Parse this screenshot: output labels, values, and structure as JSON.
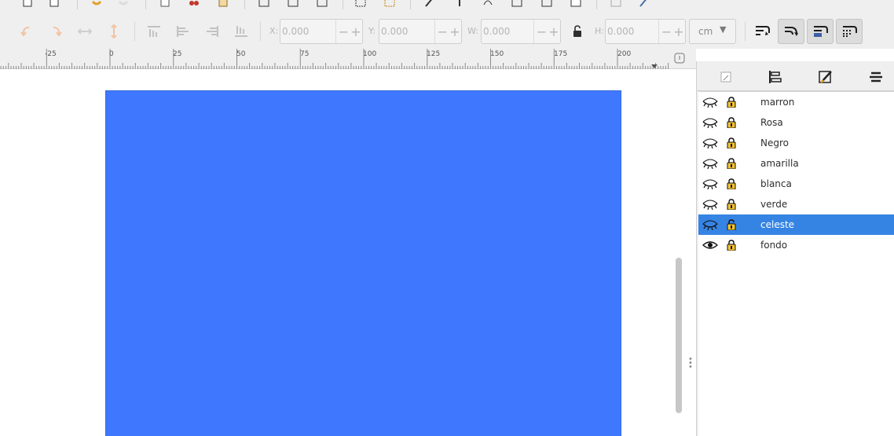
{
  "toolbar": {
    "x_label": "X:",
    "y_label": "Y:",
    "w_label": "W:",
    "h_label": "H:",
    "x_value": "0.000",
    "y_value": "0.000",
    "w_value": "0.000",
    "h_value": "0.000",
    "unit": "cm",
    "minus_glyph": "−",
    "plus_glyph": "+"
  },
  "ruler": {
    "labels": [
      "-25",
      "0",
      "25",
      "50",
      "75",
      "100",
      "125",
      "150",
      "175",
      "200"
    ]
  },
  "canvas": {
    "page_color": "#3f78ff"
  },
  "layers_panel": {
    "selected_color": "#3584e4",
    "layers": [
      {
        "name": "marron",
        "visible": false,
        "locked": true
      },
      {
        "name": "Rosa",
        "visible": false,
        "locked": true
      },
      {
        "name": "Negro",
        "visible": false,
        "locked": true
      },
      {
        "name": "amarilla",
        "visible": false,
        "locked": true
      },
      {
        "name": "blanca",
        "visible": false,
        "locked": true
      },
      {
        "name": "verde",
        "visible": false,
        "locked": true
      },
      {
        "name": "celeste",
        "visible": false,
        "locked": false,
        "selected": true
      },
      {
        "name": "fondo",
        "visible": true,
        "locked": true
      }
    ]
  }
}
